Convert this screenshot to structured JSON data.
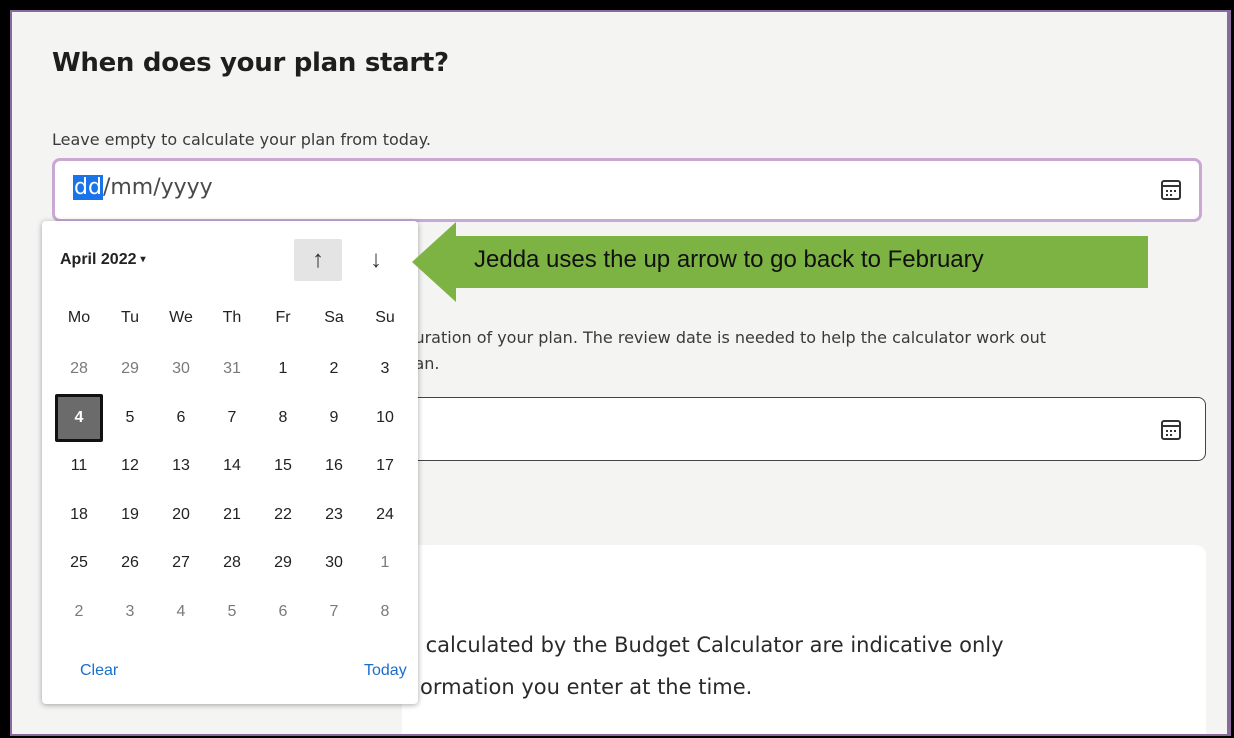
{
  "form": {
    "title": "When does your plan start?",
    "hint": "Leave empty to calculate your plan from today.",
    "start_date": {
      "mask_selected": "dd",
      "mask_rest": "/mm/yyyy"
    },
    "review_text_line1": "luration of your plan. The review date is needed to help the calculator work out",
    "review_text_line2": "lan."
  },
  "notice": {
    "line1": "s calculated by the Budget Calculator are indicative only",
    "line2": "ormation you enter at the time."
  },
  "picker": {
    "month_label": "April 2022",
    "caret": "▾",
    "nav_up": "↑",
    "nav_down": "↓",
    "weekdays": [
      "Mo",
      "Tu",
      "We",
      "Th",
      "Fr",
      "Sa",
      "Su"
    ],
    "weeks": [
      [
        {
          "d": "28",
          "m": true
        },
        {
          "d": "29",
          "m": true
        },
        {
          "d": "30",
          "m": true
        },
        {
          "d": "31",
          "m": true
        },
        {
          "d": "1"
        },
        {
          "d": "2"
        },
        {
          "d": "3"
        }
      ],
      [
        {
          "d": "4",
          "t": true
        },
        {
          "d": "5"
        },
        {
          "d": "6"
        },
        {
          "d": "7"
        },
        {
          "d": "8"
        },
        {
          "d": "9"
        },
        {
          "d": "10"
        }
      ],
      [
        {
          "d": "11"
        },
        {
          "d": "12"
        },
        {
          "d": "13"
        },
        {
          "d": "14"
        },
        {
          "d": "15"
        },
        {
          "d": "16"
        },
        {
          "d": "17"
        }
      ],
      [
        {
          "d": "18"
        },
        {
          "d": "19"
        },
        {
          "d": "20"
        },
        {
          "d": "21"
        },
        {
          "d": "22"
        },
        {
          "d": "23"
        },
        {
          "d": "24"
        }
      ],
      [
        {
          "d": "25"
        },
        {
          "d": "26"
        },
        {
          "d": "27"
        },
        {
          "d": "28"
        },
        {
          "d": "29"
        },
        {
          "d": "30"
        },
        {
          "d": "1",
          "m": true
        }
      ],
      [
        {
          "d": "2",
          "m": true
        },
        {
          "d": "3",
          "m": true
        },
        {
          "d": "4",
          "m": true
        },
        {
          "d": "5",
          "m": true
        },
        {
          "d": "6",
          "m": true
        },
        {
          "d": "7",
          "m": true
        },
        {
          "d": "8",
          "m": true
        }
      ]
    ],
    "clear_label": "Clear",
    "today_label": "Today"
  },
  "callout": {
    "text": "Jedda uses the up arrow to go back to February",
    "color": "#7cb342"
  }
}
